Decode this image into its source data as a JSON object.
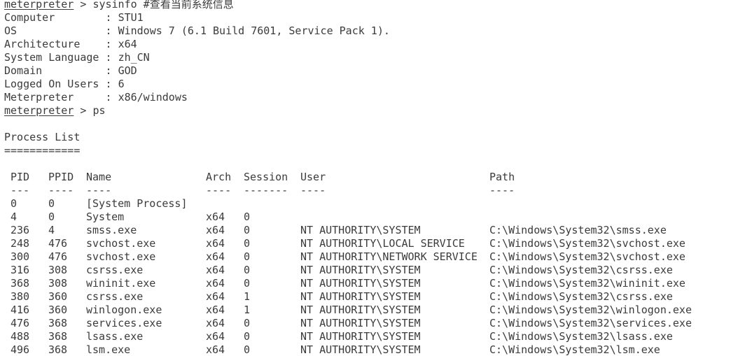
{
  "prompt": {
    "word": "meterpreter",
    "separator": " > "
  },
  "commands": {
    "sysinfo": "sysinfo #查看当前系统信息",
    "ps": "ps"
  },
  "sysinfo": [
    {
      "key": "Computer       ",
      "value": "STU1"
    },
    {
      "key": "OS             ",
      "value": "Windows 7 (6.1 Build 7601, Service Pack 1)."
    },
    {
      "key": "Architecture   ",
      "value": "x64"
    },
    {
      "key": "System Language",
      "value": "zh_CN"
    },
    {
      "key": "Domain         ",
      "value": "GOD"
    },
    {
      "key": "Logged On Users",
      "value": "6"
    },
    {
      "key": "Meterpreter    ",
      "value": "x86/windows"
    }
  ],
  "sysinfo_separator": " : ",
  "process_list": {
    "title": "Process List",
    "title_rule": "============",
    "headers": {
      "pid": "PID",
      "ppid": "PPID",
      "name": "Name",
      "arch": "Arch",
      "session": "Session",
      "user": "User",
      "path": "Path"
    },
    "header_rules": {
      "pid": "---",
      "ppid": "----",
      "name": "----",
      "arch": "----",
      "session": "-------",
      "user": "----",
      "path": "----"
    },
    "rows": [
      {
        "pid": "0",
        "ppid": "0",
        "name": "[System Process]",
        "arch": "",
        "session": "",
        "user": "",
        "path": ""
      },
      {
        "pid": "4",
        "ppid": "0",
        "name": "System",
        "arch": "x64",
        "session": "0",
        "user": "",
        "path": ""
      },
      {
        "pid": "236",
        "ppid": "4",
        "name": "smss.exe",
        "arch": "x64",
        "session": "0",
        "user": "NT AUTHORITY\\SYSTEM",
        "path": "C:\\Windows\\System32\\smss.exe"
      },
      {
        "pid": "248",
        "ppid": "476",
        "name": "svchost.exe",
        "arch": "x64",
        "session": "0",
        "user": "NT AUTHORITY\\LOCAL SERVICE",
        "path": "C:\\Windows\\System32\\svchost.exe"
      },
      {
        "pid": "300",
        "ppid": "476",
        "name": "svchost.exe",
        "arch": "x64",
        "session": "0",
        "user": "NT AUTHORITY\\NETWORK SERVICE",
        "path": "C:\\Windows\\System32\\svchost.exe"
      },
      {
        "pid": "316",
        "ppid": "308",
        "name": "csrss.exe",
        "arch": "x64",
        "session": "0",
        "user": "NT AUTHORITY\\SYSTEM",
        "path": "C:\\Windows\\System32\\csrss.exe"
      },
      {
        "pid": "368",
        "ppid": "308",
        "name": "wininit.exe",
        "arch": "x64",
        "session": "0",
        "user": "NT AUTHORITY\\SYSTEM",
        "path": "C:\\Windows\\System32\\wininit.exe"
      },
      {
        "pid": "380",
        "ppid": "360",
        "name": "csrss.exe",
        "arch": "x64",
        "session": "1",
        "user": "NT AUTHORITY\\SYSTEM",
        "path": "C:\\Windows\\System32\\csrss.exe"
      },
      {
        "pid": "416",
        "ppid": "360",
        "name": "winlogon.exe",
        "arch": "x64",
        "session": "1",
        "user": "NT AUTHORITY\\SYSTEM",
        "path": "C:\\Windows\\System32\\winlogon.exe"
      },
      {
        "pid": "476",
        "ppid": "368",
        "name": "services.exe",
        "arch": "x64",
        "session": "0",
        "user": "NT AUTHORITY\\SYSTEM",
        "path": "C:\\Windows\\System32\\services.exe"
      },
      {
        "pid": "488",
        "ppid": "368",
        "name": "lsass.exe",
        "arch": "x64",
        "session": "0",
        "user": "NT AUTHORITY\\SYSTEM",
        "path": "C:\\Windows\\System32\\lsass.exe"
      },
      {
        "pid": "496",
        "ppid": "368",
        "name": "lsm.exe",
        "arch": "x64",
        "session": "0",
        "user": "NT AUTHORITY\\SYSTEM",
        "path": "C:\\Windows\\System32\\lsm.exe"
      }
    ]
  }
}
